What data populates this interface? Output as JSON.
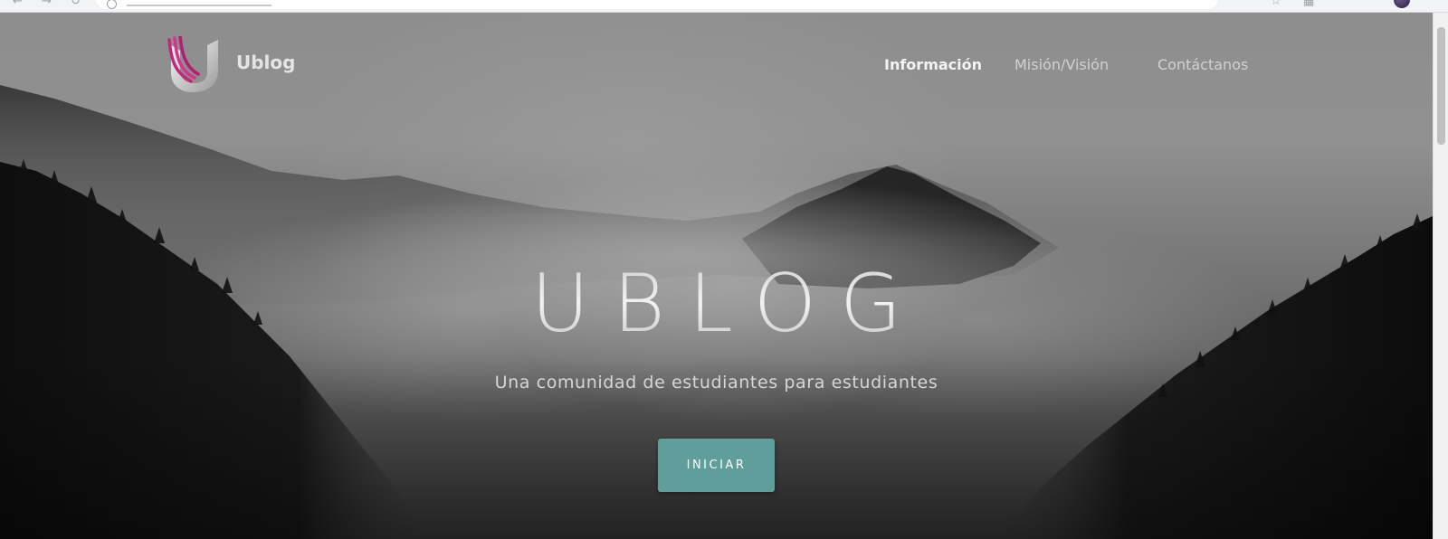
{
  "brand": {
    "name": "Ublog",
    "logo_colors": {
      "stripes": "#c0287a",
      "u_shape": "#e8e8e8"
    }
  },
  "nav": {
    "items": [
      {
        "label": "Información",
        "active": true
      },
      {
        "label": "Misión/Visión",
        "active": false
      },
      {
        "label": "Contáctanos",
        "active": false
      }
    ]
  },
  "hero": {
    "title": "UBLOG",
    "subtitle": "Una comunidad de estudiantes para estudiantes",
    "cta_label": "INICIAR"
  },
  "colors": {
    "cta_background": "#5f9e9a",
    "nav_text": "#d2d2d2",
    "nav_active_text": "#f4f4f4"
  },
  "icons": [
    "back-arrow-icon",
    "forward-arrow-icon",
    "reload-icon",
    "site-info-icon",
    "star-icon",
    "extensions-icon",
    "profile-avatar-icon"
  ]
}
